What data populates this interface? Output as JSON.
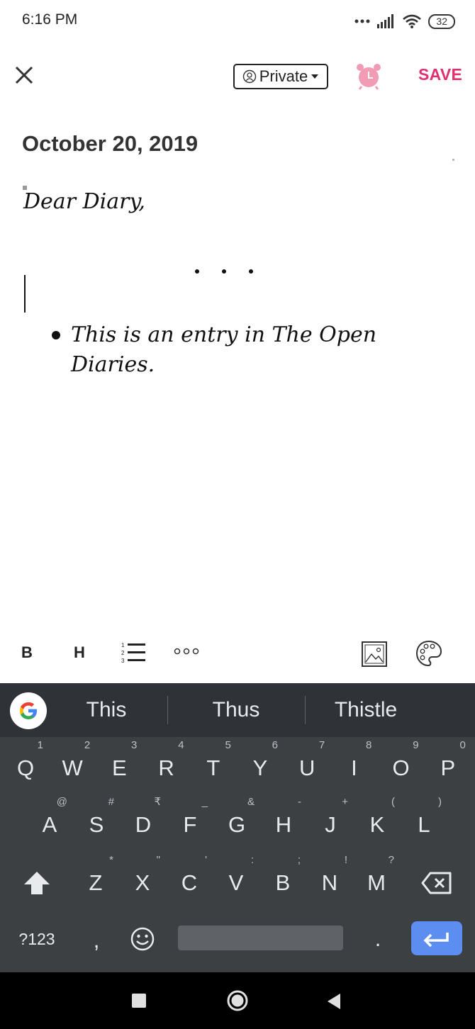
{
  "status_bar": {
    "time": "6:16 PM",
    "battery": "32"
  },
  "header": {
    "privacy_label": "Private",
    "save_label": "SAVE"
  },
  "entry": {
    "date": "October 20, 2019",
    "greeting": "Dear Diary,",
    "bullet_text": "This is an entry in The Open Diaries."
  },
  "toolbar": {
    "bold_label": "B",
    "heading_label": "H"
  },
  "keyboard": {
    "suggestions": [
      "This",
      "Thus",
      "Thistle"
    ],
    "row1": [
      {
        "k": "Q",
        "h": "1"
      },
      {
        "k": "W",
        "h": "2"
      },
      {
        "k": "E",
        "h": "3"
      },
      {
        "k": "R",
        "h": "4"
      },
      {
        "k": "T",
        "h": "5"
      },
      {
        "k": "Y",
        "h": "6"
      },
      {
        "k": "U",
        "h": "7"
      },
      {
        "k": "I",
        "h": "8"
      },
      {
        "k": "O",
        "h": "9"
      },
      {
        "k": "P",
        "h": "0"
      }
    ],
    "row2": [
      {
        "k": "A",
        "h": "@"
      },
      {
        "k": "S",
        "h": "#"
      },
      {
        "k": "D",
        "h": "₹"
      },
      {
        "k": "F",
        "h": "_"
      },
      {
        "k": "G",
        "h": "&"
      },
      {
        "k": "H",
        "h": "-"
      },
      {
        "k": "J",
        "h": "+"
      },
      {
        "k": "K",
        "h": "("
      },
      {
        "k": "L",
        "h": ")"
      }
    ],
    "row3": [
      {
        "k": "Z",
        "h": "*"
      },
      {
        "k": "X",
        "h": "\""
      },
      {
        "k": "C",
        "h": "'"
      },
      {
        "k": "V",
        "h": ":"
      },
      {
        "k": "B",
        "h": ";"
      },
      {
        "k": "N",
        "h": "!"
      },
      {
        "k": "M",
        "h": "?"
      }
    ],
    "symbols_label": "?123",
    "comma": ",",
    "period": "."
  }
}
